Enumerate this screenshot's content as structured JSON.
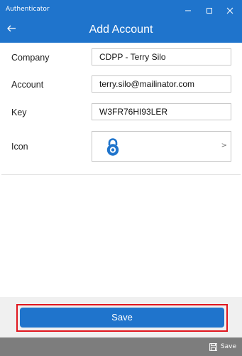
{
  "window": {
    "title": "Authenticator"
  },
  "header": {
    "title": "Add Account"
  },
  "form": {
    "company_label": "Company",
    "company_value": "CDPP - Terry Silo",
    "account_label": "Account",
    "account_value": "terry.silo@mailinator.com",
    "key_label": "Key",
    "key_value": "W3FR76HI93LER",
    "icon_label": "Icon",
    "icon_selected": "lock-icon",
    "icon_chevron": ">"
  },
  "actions": {
    "save_label": "Save"
  },
  "appbar": {
    "save_label": "Save"
  },
  "colors": {
    "accent": "#1f74cc",
    "highlight": "#e0161e",
    "appbar": "#7d7d7d"
  }
}
